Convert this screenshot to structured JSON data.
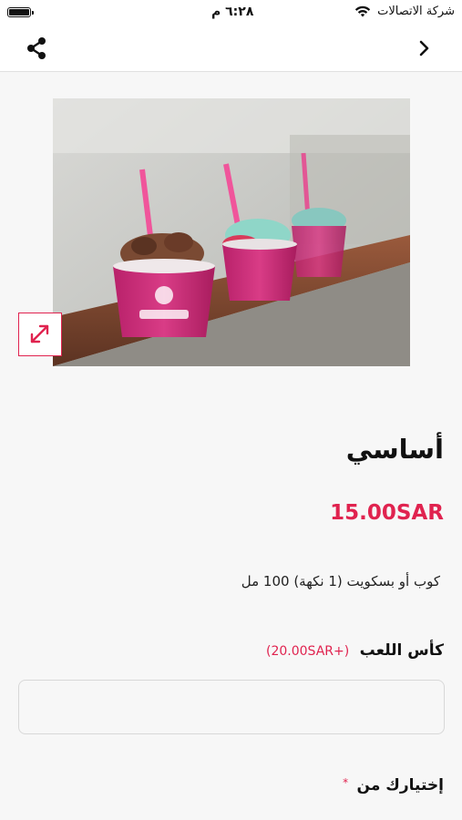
{
  "status_bar": {
    "carrier": "شركة الاتصالات",
    "time": "٦:٢٨ م",
    "icons": [
      "battery-icon",
      "wifi-icon"
    ]
  },
  "nav": {
    "icons": [
      "share-icon",
      "chevron-right-icon"
    ]
  },
  "product": {
    "image_alt": "product-photo",
    "expand_icon": "expand-icon",
    "title": "أساسي",
    "price": "15.00SAR",
    "description": "كوب أو بسكويت (1 نكهة) 100 مل"
  },
  "options": {
    "addon_label": "كأس اللعب",
    "addon_price": "(+20.00SAR)",
    "choice_label": "إختيارك من",
    "required_mark": "*"
  },
  "colors": {
    "accent": "#e0234f",
    "background": "#f7f7f7",
    "surface": "#ffffff"
  }
}
